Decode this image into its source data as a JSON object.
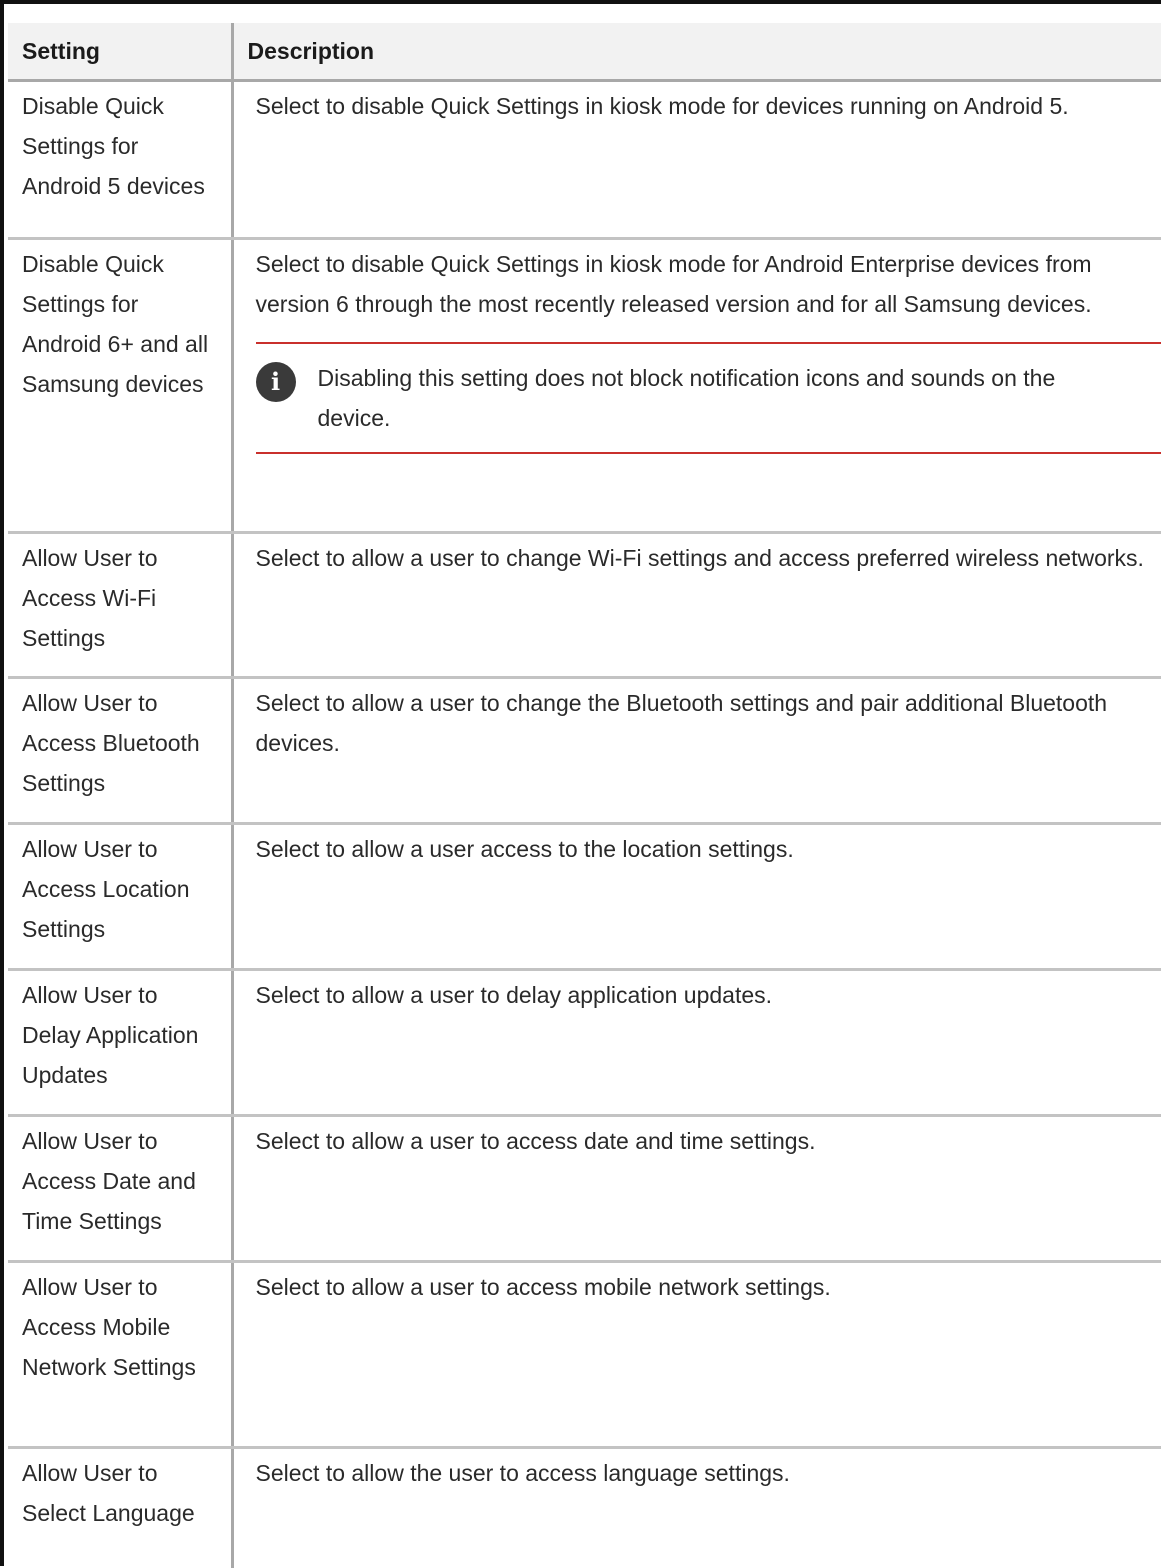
{
  "table": {
    "headers": {
      "setting": "Setting",
      "description": "Description"
    },
    "rows": [
      {
        "setting": "Disable Quick Settings for Android 5 devices",
        "description": "Select to disable Quick Settings in kiosk mode for devices running on Android 5."
      },
      {
        "setting": "Disable Quick Settings for Android 6+ and all Samsung devices",
        "description": "Select to disable Quick Settings in kiosk mode for Android Enterprise devices from version 6 through the most recently released version and for all Samsung devices.",
        "note": {
          "icon": "info-icon",
          "text": "Disabling this setting does not block notification icons and sounds on the device."
        }
      },
      {
        "setting": "Allow User to Access Wi-Fi Settings",
        "description": "Select to allow a  user to change Wi-Fi settings and access preferred wireless networks."
      },
      {
        "setting": "Allow User to Access Bluetooth Settings",
        "description": "Select to allow a user to change the Bluetooth settings and pair additional Bluetooth devices."
      },
      {
        "setting": "Allow User to Access Location Settings",
        "description": "Select to allow a user access to the location settings."
      },
      {
        "setting": "Allow User to Delay Application Updates",
        "description": "Select to allow a user to delay application updates."
      },
      {
        "setting": "Allow User to Access Date and Time Settings",
        "description": "Select to allow a user to access date and time settings."
      },
      {
        "setting": "Allow User to Access Mobile Network Settings",
        "description": "Select to allow a user to access mobile network settings."
      },
      {
        "setting": "Allow User to Select Language",
        "description": "Select to allow the user to access language settings."
      }
    ]
  },
  "colors": {
    "header_background": "#f2f2f2",
    "grid_line": "#a8a8a8",
    "note_rule": "#c9302c",
    "info_icon": "#3a3a3a"
  }
}
